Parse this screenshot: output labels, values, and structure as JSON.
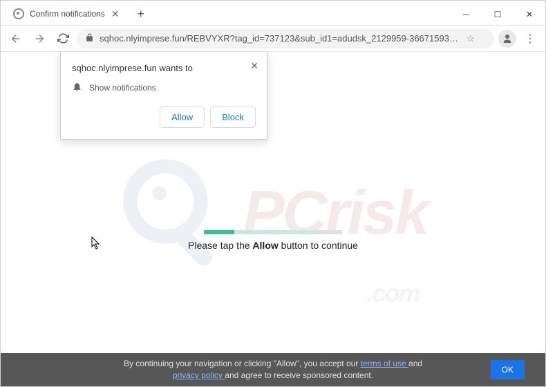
{
  "tab": {
    "title": "Confirm notifications"
  },
  "address": {
    "url": "sqhoc.nlyimprese.fun/REBVYXR?tag_id=737123&sub_id1=adudsk_2129959-3667159316-0_Kaunas_Chrome&sub_id2=70..."
  },
  "permission": {
    "title": "sqhoc.nlyimprese.fun wants to",
    "item": "Show notifications",
    "allow": "Allow",
    "block": "Block"
  },
  "page": {
    "text_before": "Please tap the ",
    "text_bold": "Allow",
    "text_after": " button to continue"
  },
  "footer": {
    "line1_before": "By continuing your navigation or clicking \"Allow\", you accept our ",
    "terms": "terms of use ",
    "line1_mid": "and",
    "privacy": "privacy policy ",
    "line2": "and agree to receive sponsored content.",
    "ok": "OK"
  },
  "watermark": {
    "text": "PCrisk",
    "sub": ".com"
  }
}
